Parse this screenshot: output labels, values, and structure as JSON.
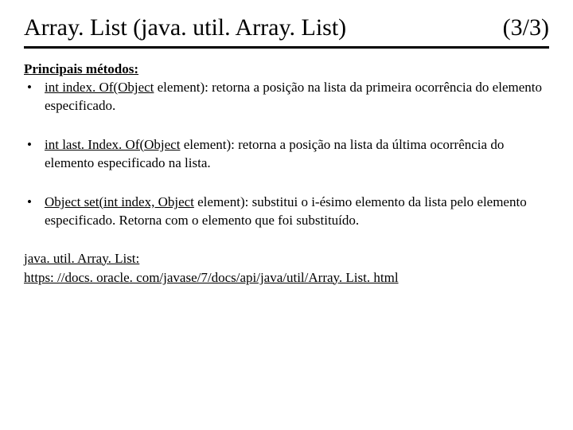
{
  "title": {
    "left": "Array. List (java. util. Array. List)",
    "right": "(3/3)"
  },
  "sectionHeading": "Principais métodos:",
  "methods": [
    {
      "signature": "int index. Of(Object",
      "tail": " element): retorna a posição na lista da primeira ocorrência do elemento especificado."
    },
    {
      "signature": "int last. Index. Of(Object",
      "tail": " element): retorna a posição na lista da última ocorrência do elemento especificado na lista."
    },
    {
      "signature": "Object set(int index, Object",
      "tail": " element): substitui o i-ésimo elemento da lista pelo elemento especificado. Retorna com o elemento que foi substituído."
    }
  ],
  "footer": {
    "label": "java. util. Array. List:",
    "link": "https: //docs. oracle. com/javase/7/docs/api/java/util/Array. List. html"
  }
}
